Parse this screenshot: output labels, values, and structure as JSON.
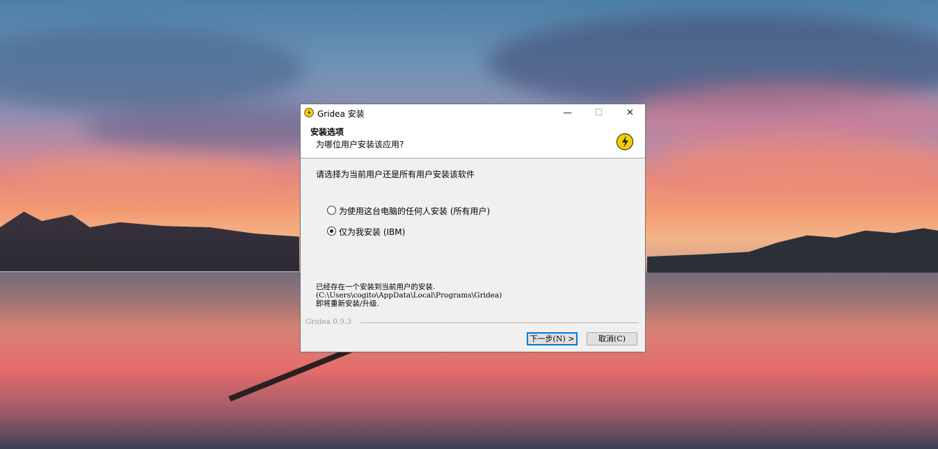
{
  "window": {
    "title": "Gridea 安装",
    "minimize_glyph": "—",
    "maximize_glyph": "☐",
    "close_glyph": "✕",
    "app_icon": "gridea-logo-icon"
  },
  "header": {
    "title": "安装选项",
    "subtitle": "为哪位用户安装该应用?",
    "icon": "gridea-logo-icon"
  },
  "body": {
    "prompt": "请选择为当前用户还是所有用户安装该软件",
    "options": [
      {
        "label": "为使用这台电脑的任何人安装 (所有用户)",
        "selected": false
      },
      {
        "label": "仅为我安装 (IBM)",
        "selected": true
      }
    ],
    "info_lines": [
      "已经存在一个安装到当前用户的安装.",
      "(C:\\Users\\cogito\\AppData\\Local\\Programs\\Gridea)",
      "即将重新安装/升级."
    ]
  },
  "footer": {
    "version": "Gridea 0.9.3",
    "next_label": "下一步(N) >",
    "cancel_label": "取消(C)"
  },
  "colors": {
    "accent": "#0078d7",
    "logo_yellow": "#f5d000"
  }
}
